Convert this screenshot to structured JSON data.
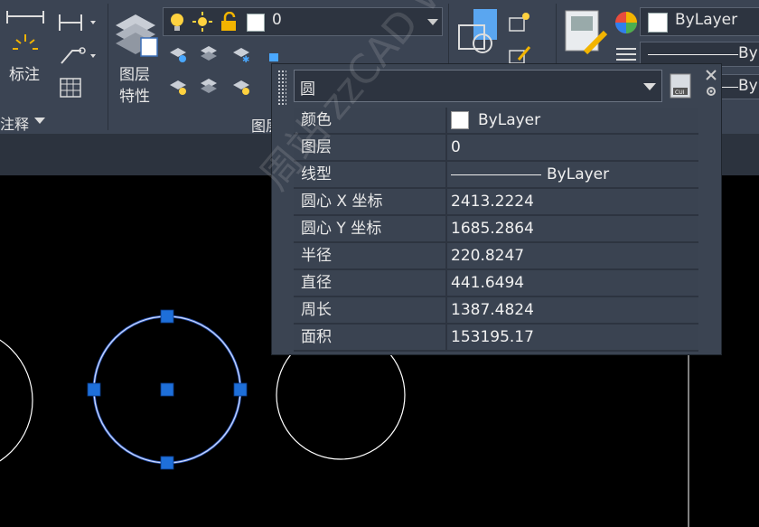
{
  "ribbon": {
    "dimension_label": "标注",
    "annotation_panel_label": "注释",
    "layer_properties_label_line1": "图层",
    "layer_properties_label_line2": "特性",
    "layer_panel_label": "图层",
    "current_layer": "0",
    "color_value": "ByLayer",
    "linetype_value": "ByL",
    "lineweight_value": "ByL"
  },
  "palette": {
    "object_type": "圆",
    "rows": [
      {
        "name": "颜色",
        "value": "ByLayer"
      },
      {
        "name": "图层",
        "value": "0"
      },
      {
        "name": "线型",
        "value": "ByLayer"
      },
      {
        "name": "圆心 X 坐标",
        "value": "2413.2224"
      },
      {
        "name": "圆心 Y 坐标",
        "value": "1685.2864"
      },
      {
        "name": "半径",
        "value": "220.8247"
      },
      {
        "name": "直径",
        "value": "441.6494"
      },
      {
        "name": "周长",
        "value": "1387.4824"
      },
      {
        "name": "面积",
        "value": "153195.17"
      }
    ]
  },
  "watermark": "周站 zzCAD www.zzcad.com",
  "colors": {
    "ribbon_bg": "#3b4453",
    "palette_bg": "#3b4452",
    "selection_blue": "#1e6fd9",
    "circle_stroke": "#ffffff"
  }
}
